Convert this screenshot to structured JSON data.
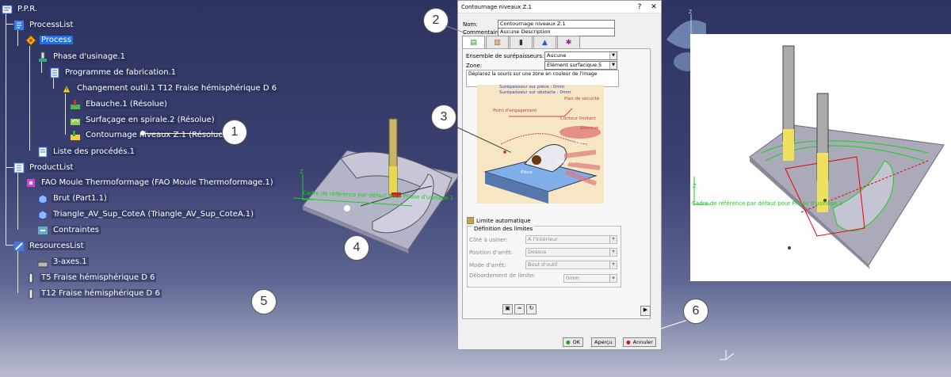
{
  "tree": {
    "items": [
      {
        "label": "P.P.R.",
        "icon": "ppr-icon"
      },
      {
        "label": "ProcessList",
        "icon": "process-list-icon"
      },
      {
        "label": "Process",
        "icon": "process-icon"
      },
      {
        "label": "Phase d'usinage.1",
        "icon": "machining-phase-icon"
      },
      {
        "label": "Programme de fabrication.1",
        "icon": "program-icon"
      },
      {
        "label": "Changement outil.1  T12 Fraise hémisphérique D 6",
        "icon": "tool-change-icon"
      },
      {
        "label": "Ebauche.1 (Résolue)",
        "icon": "roughing-icon"
      },
      {
        "label": "Surfaçage en spirale.2 (Résolue)",
        "icon": "spiral-facing-icon"
      },
      {
        "label": "Contournage niveaux Z.1 (Résolue)",
        "icon": "z-level-icon"
      },
      {
        "label": "Liste des procédés.1",
        "icon": "process-list-doc-icon"
      },
      {
        "label": "ProductList",
        "icon": "product-list-icon"
      },
      {
        "label": "FAO Moule Thermoformage (FAO Moule Thermoformage.1)",
        "icon": "product-icon"
      },
      {
        "label": "Brut (Part1.1)",
        "icon": "part-icon"
      },
      {
        "label": "Triangle_AV_Sup_CoteA (Triangle_AV_Sup_CoteA.1)",
        "icon": "part-icon"
      },
      {
        "label": "Contraintes",
        "icon": "constraints-icon"
      },
      {
        "label": "ResourcesList",
        "icon": "resources-list-icon"
      },
      {
        "label": "3-axes.1",
        "icon": "machine-icon"
      },
      {
        "label": "T5 Fraise hémisphérique D 6",
        "icon": "tool-icon"
      },
      {
        "label": "T12 Fraise hémisphérique D 6",
        "icon": "tool-icon"
      }
    ]
  },
  "dialog": {
    "title": "Contournage niveaux Z.1",
    "help_label": "?",
    "close_label": "✕",
    "name_label": "Nom:",
    "name_value": "Contournage niveaux Z.1",
    "comment_label": "Commentaire:",
    "comment_value": "Aucune Description",
    "offset_group_label": "Ensemble de surépaisseurs:",
    "offset_group_value": "Aucune",
    "zone_label": "Zone:",
    "zone_value": "Elément surfacique.5",
    "hint": "Déplacez la souris sur une zone en couleur de l'image",
    "img_part_offset": "Surépaisseur sur pièce : 0mm",
    "img_check_offset": "Surépaisseur sur obstacle : 0mm",
    "img_safety_plane": "Plan de sécurité",
    "img_entry_point": "Point d'engagement",
    "img_limit_contour": "Contour limitant",
    "img_top": "Sommet",
    "img_bottom": "Fond",
    "img_check": "Obstacle",
    "img_part": "Pièce",
    "auto_limit_label": "Limite automatique",
    "limits_group_label": "Définition des limites",
    "side_label": "Côté à usiner:",
    "side_value": "A l'intérieur",
    "stop_position_label": "Position d'arrêt:",
    "stop_position_value": "Dessus",
    "stop_mode_label": "Mode d'arrêt:",
    "stop_mode_value": "Bout d'outil",
    "overshoot_label": "Débordement de limite:",
    "overshoot_value": "0mm",
    "ok_label": "OK",
    "preview_label": "Aperçu",
    "cancel_label": "Annuler"
  },
  "viewport": {
    "frame_label": "Cadre de référence par défaut pour Phase d'usinage.1",
    "frame_label_right": "Cadre de référence par défaut pour Phase d'usinage.1",
    "axis_x": "X",
    "axis_y": "Y",
    "axis_z": "Z"
  },
  "callouts": [
    "1",
    "2",
    "3",
    "4",
    "5",
    "6"
  ],
  "colors": {
    "background_top": "#2e3460",
    "selection": "#1e6ff2",
    "axis_green": "#19d119"
  }
}
